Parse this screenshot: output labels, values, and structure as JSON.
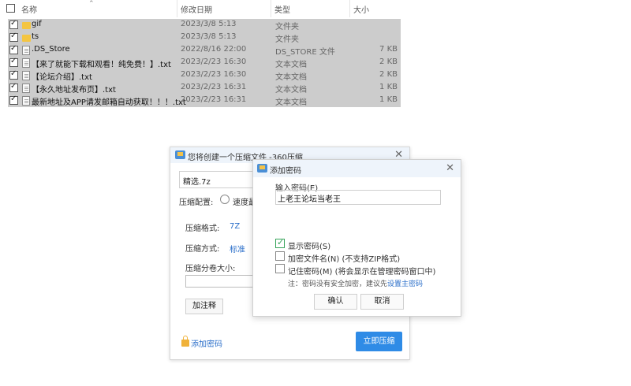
{
  "explorer": {
    "columns": {
      "name": "名称",
      "date": "修改日期",
      "type": "类型",
      "size": "大小"
    },
    "files": [
      {
        "name": "gif",
        "date": "2023/3/8 5:13",
        "type": "文件夹",
        "size": "",
        "kind": "folder-icon"
      },
      {
        "name": "ts",
        "date": "2023/3/8 5:13",
        "type": "文件夹",
        "size": "",
        "kind": "folder-icon"
      },
      {
        "name": ".DS_Store",
        "date": "2022/8/16 22:00",
        "type": "DS_STORE 文件",
        "size": "7 KB",
        "kind": "file-icon"
      },
      {
        "name": "【来了就能下载和观看！纯免费！】.txt",
        "date": "2023/2/23 16:30",
        "type": "文本文档",
        "size": "2 KB",
        "kind": "text-file-icon"
      },
      {
        "name": "【论坛介绍】.txt",
        "date": "2023/2/23 16:30",
        "type": "文本文档",
        "size": "2 KB",
        "kind": "text-file-icon"
      },
      {
        "name": "【永久地址发布页】.txt",
        "date": "2023/2/23 16:31",
        "type": "文本文档",
        "size": "1 KB",
        "kind": "text-file-icon"
      },
      {
        "name": "最新地址及APP请发邮箱自动获取！！！.txt",
        "date": "2023/2/23 16:31",
        "type": "文本文档",
        "size": "1 KB",
        "kind": "text-file-icon"
      }
    ]
  },
  "compress_dialog": {
    "title": "您将创建一个压缩文件 -360压缩",
    "filename": "精选.7z",
    "config_label": "压缩配置:",
    "config_option": "速度最",
    "format_label": "压缩格式:",
    "format_value": "7Z",
    "method_label": "压缩方式:",
    "method_value": "标准",
    "volume_label": "压缩分卷大小:",
    "comment_button": "加注释",
    "add_password_link": "添加密码",
    "compress_button": "立即压缩"
  },
  "password_dialog": {
    "title": "添加密码",
    "input_label": "输入密码(E)",
    "password_value": "上老王论坛当老王",
    "show_password": "显示密码(S)",
    "encrypt_names": "加密文件名(N) (不支持ZIP格式)",
    "remember_password": "记住密码(M) (将会显示在管理密码窗口中)",
    "note_prefix": "注：密码没有安全加密，建议先",
    "note_link": "设置主密码",
    "ok_button": "确认",
    "cancel_button": "取消"
  },
  "colors": {
    "selection": "#cccccc",
    "accent": "#2f8be6",
    "link": "#2a6ec9",
    "check_green": "#36a35a"
  }
}
